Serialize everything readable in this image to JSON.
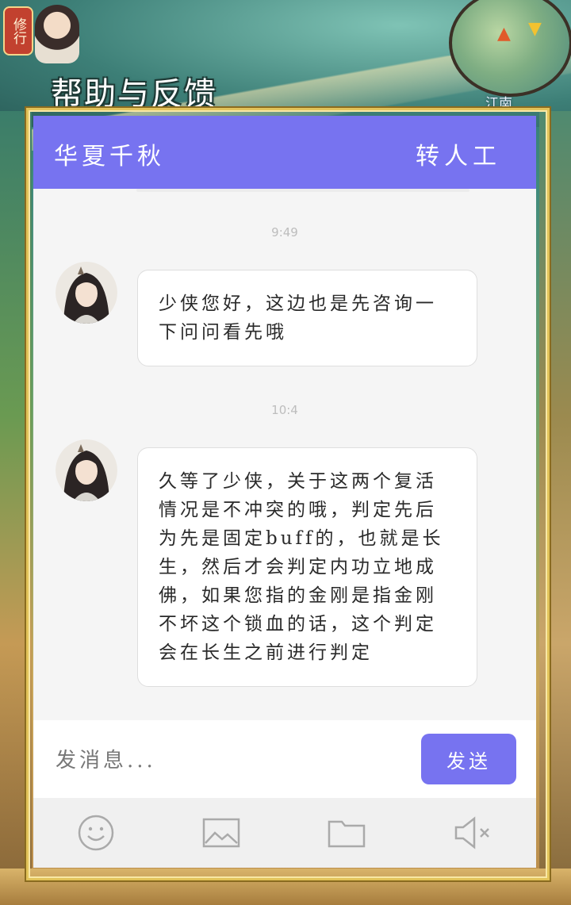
{
  "game_bg": {
    "badge_label": "修行",
    "location_label": "江南"
  },
  "page_title": "帮助与反馈",
  "chat": {
    "brand": "华夏千秋",
    "transfer_label": "转人工",
    "messages": [
      {
        "time": "9:49",
        "text": "少侠您好，这边也是先咨询一下问问看先哦"
      },
      {
        "time": "10:4",
        "text": "久等了少侠，关于这两个复活情况是不冲突的哦，判定先后为先是固定buff的，也就是长生，然后才会判定内功立地成佛，如果您指的金刚是指金刚不坏这个锁血的话，这个判定会在长生之前进行判定"
      }
    ],
    "input_placeholder": "发消息...",
    "send_label": "发送"
  },
  "toolbar": {
    "items": [
      "emoji-icon",
      "image-icon",
      "folder-icon",
      "mute-icon"
    ]
  },
  "colors": {
    "accent": "#7773f0",
    "panel_bg": "#f5f5f5",
    "frame_gold": "#e2c35a"
  }
}
